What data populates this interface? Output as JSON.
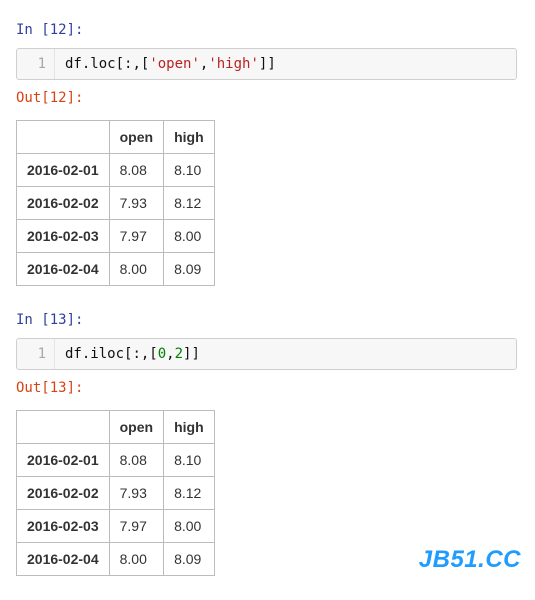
{
  "cells": [
    {
      "in_label": "In [12]:",
      "out_label": "Out[12]:",
      "line_no": "1",
      "code": {
        "p0": "df",
        "p1": ".loc[",
        "p2": ":",
        "p3": ",[",
        "s0": "'open'",
        "p4": ",",
        "s1": "'high'",
        "p5": "]]"
      },
      "table": {
        "columns": [
          "open",
          "high"
        ],
        "rows": [
          {
            "idx": "2016-02-01",
            "open": "8.08",
            "high": "8.10"
          },
          {
            "idx": "2016-02-02",
            "open": "7.93",
            "high": "8.12"
          },
          {
            "idx": "2016-02-03",
            "open": "7.97",
            "high": "8.00"
          },
          {
            "idx": "2016-02-04",
            "open": "8.00",
            "high": "8.09"
          }
        ]
      }
    },
    {
      "in_label": "In [13]:",
      "out_label": "Out[13]:",
      "line_no": "1",
      "code": {
        "p0": "df",
        "p1": ".iloc[",
        "p2": ":",
        "p3": ",[",
        "n0": "0",
        "p4": ",",
        "n1": "2",
        "p5": "]]"
      },
      "table": {
        "columns": [
          "open",
          "high"
        ],
        "rows": [
          {
            "idx": "2016-02-01",
            "open": "8.08",
            "high": "8.10"
          },
          {
            "idx": "2016-02-02",
            "open": "7.93",
            "high": "8.12"
          },
          {
            "idx": "2016-02-03",
            "open": "7.97",
            "high": "8.00"
          },
          {
            "idx": "2016-02-04",
            "open": "8.00",
            "high": "8.09"
          }
        ]
      }
    }
  ],
  "watermark": "JB51.CC"
}
